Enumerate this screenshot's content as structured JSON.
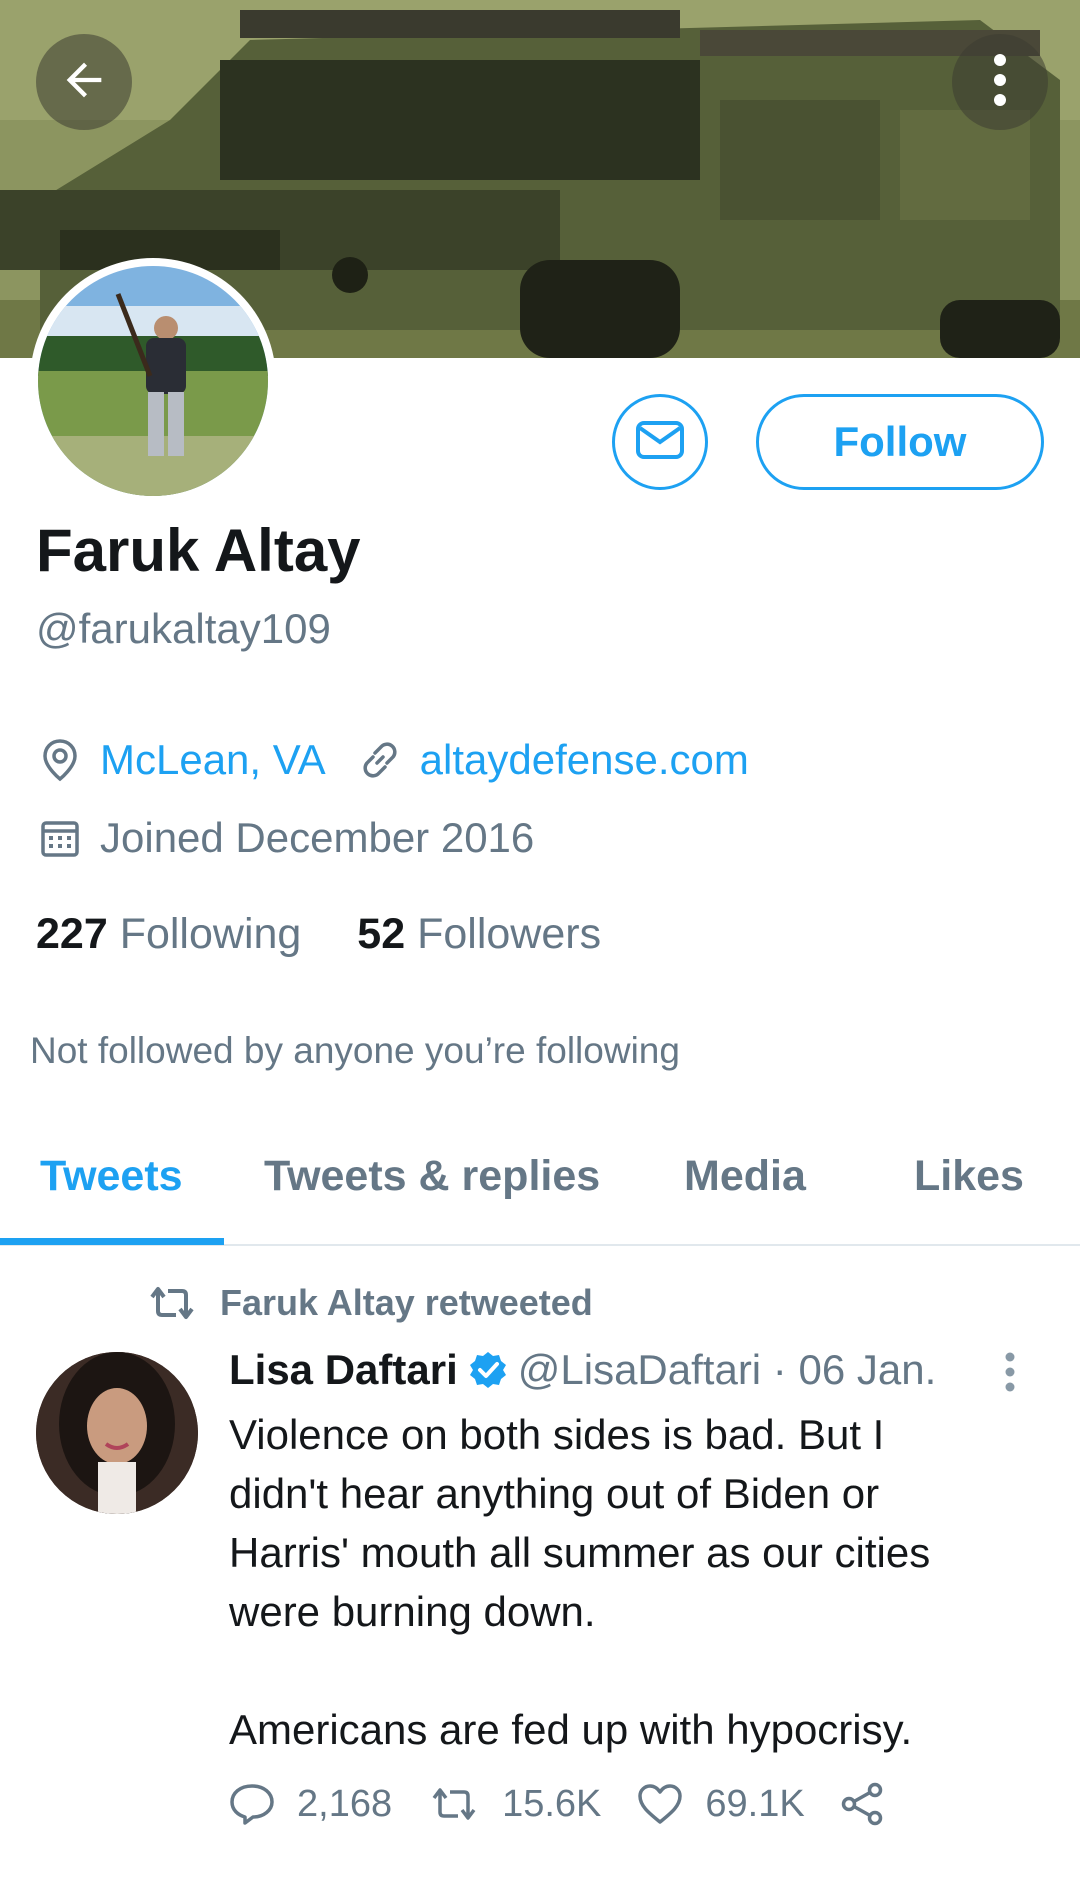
{
  "colors": {
    "accent": "#1da1f2",
    "secondary_text": "#657786",
    "primary_text": "#14171a",
    "verified": "#1da1f2"
  },
  "header": {
    "back_icon": "arrow-left-icon",
    "more_icon": "more-vertical-icon"
  },
  "profile": {
    "name": "Faruk Altay",
    "handle": "@farukaltay109",
    "location": "McLean, VA",
    "website": "altaydefense.com",
    "joined": "Joined December 2016",
    "following_count": "227",
    "following_label": "Following",
    "followers_count": "52",
    "followers_label": "Followers",
    "not_followed": "Not followed by anyone you’re following",
    "follow_label": "Follow",
    "message_icon": "mail-icon"
  },
  "tabs": [
    {
      "label": "Tweets",
      "active": true
    },
    {
      "label": "Tweets & replies",
      "active": false
    },
    {
      "label": "Media",
      "active": false
    },
    {
      "label": "Likes",
      "active": false
    }
  ],
  "tweet": {
    "retweeted_by": "Faruk Altay retweeted",
    "author": "Lisa Daftari",
    "handle_time": "@LisaDaftari · 06 Jan.",
    "text_lines": [
      "Violence on both sides is bad. But I",
      "didn't hear anything out of Biden or",
      "Harris' mouth all summer as our cities",
      "were burning down."
    ],
    "text_line_2": "Americans are fed up with hypocrisy.",
    "replies": "2,168",
    "retweets": "15.6K",
    "likes": "69.1K"
  }
}
